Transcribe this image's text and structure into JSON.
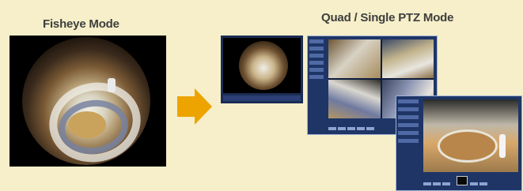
{
  "labels": {
    "fisheye_mode": "Fisheye Mode",
    "quad_single_ptz_mode": "Quad / Single PTZ Mode"
  },
  "colors": {
    "background": "#f6efc9",
    "arrow": "#eda400",
    "ui_panel": "#1e3566",
    "title_text": "#3e3e3e"
  },
  "icons": {
    "arrow": "arrow-right-icon"
  }
}
